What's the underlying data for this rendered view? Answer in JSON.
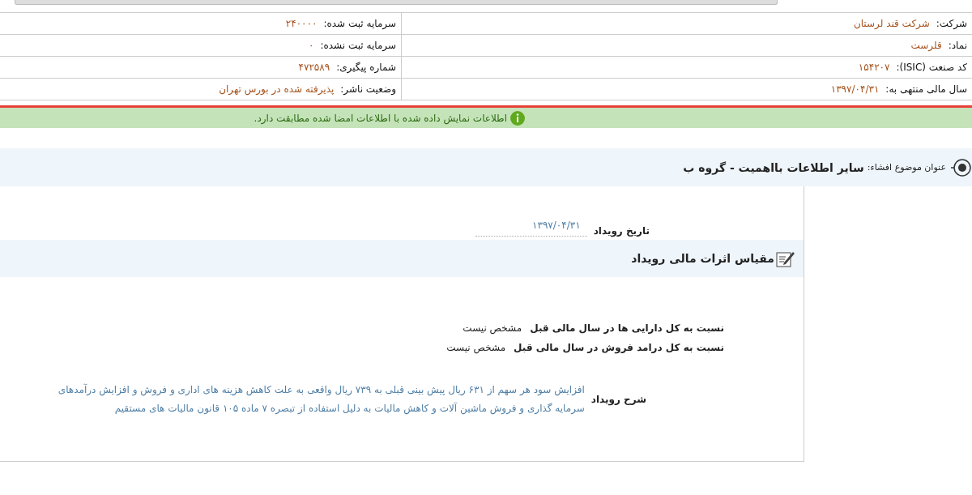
{
  "info_table": {
    "rows": [
      {
        "right": {
          "label": "شرکت:",
          "value": "شرکت قند لرستان"
        },
        "left": {
          "label": "سرمایه ثبت شده:",
          "value": "۲۴۰۰۰۰"
        }
      },
      {
        "right": {
          "label": "نماد:",
          "value": "قلرست"
        },
        "left": {
          "label": "سرمایه ثبت نشده:",
          "value": "۰"
        }
      },
      {
        "right": {
          "label": "کد صنعت (ISIC):",
          "value": "۱۵۴۲۰۷"
        },
        "left": {
          "label": "شماره پیگیری:",
          "value": "۴۷۲۵۸۹"
        }
      },
      {
        "right": {
          "label": "سال مالی منتهی به:",
          "value": "۱۳۹۷/۰۴/۳۱"
        },
        "left": {
          "label": "وضعیت ناشر:",
          "value": "پذیرفته شده در بورس تهران"
        }
      }
    ]
  },
  "notice": {
    "text": "اطلاعات نمایش داده شده با اطلاعات امضا شده مطابقت دارد."
  },
  "disclosure": {
    "label": "عنوان موضوع افشاء:",
    "title": "سایر اطلاعات بااهمیت - گروه ب"
  },
  "event_date": {
    "label": "تاریخ رویداد",
    "value": "۱۳۹۷/۰۴/۳۱"
  },
  "financial_section": {
    "title": "مقیاس اثرات مالی رویداد",
    "items": [
      {
        "label": "نسبت به کل دارایی ها در سال مالی قبل",
        "value": "مشخص نیست"
      },
      {
        "label": "نسبت به کل درامد فروش در سال مالی قبل",
        "value": "مشخص نیست"
      }
    ]
  },
  "description": {
    "label": "شرح رویداد",
    "text": "افزایش سود هر سهم از ۶۳۱ ریال پیش بینی قبلی به ۷۳۹ ریال واقعی به علت کاهش هزینه های اداری و فروش و افزایش درآمدهای سرمایه گذاری و فروش ماشین آلات و کاهش مالیات به دلیل استفاده از تبصره ۷ ماده ۱۰۵ قانون مالیات های مستقیم"
  }
}
